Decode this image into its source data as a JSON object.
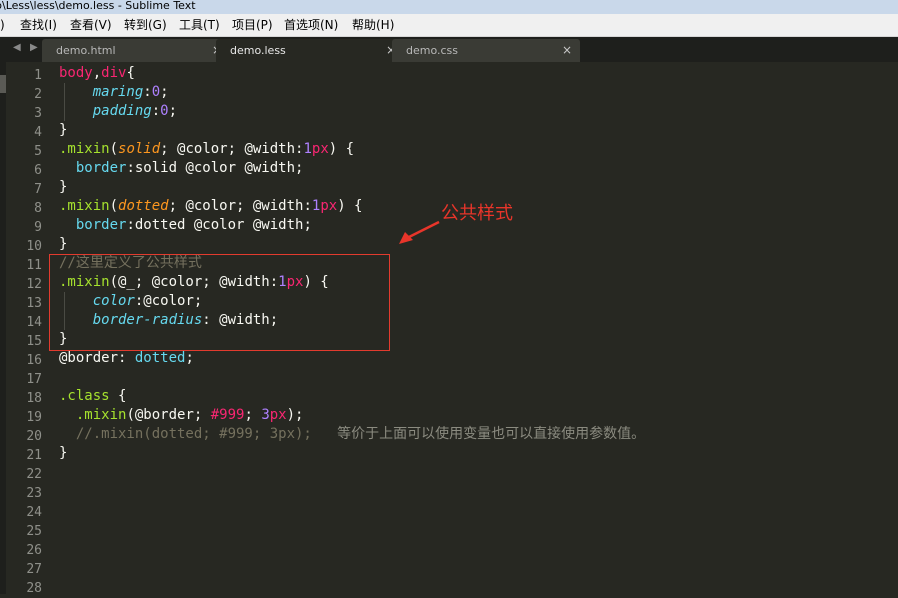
{
  "window": {
    "title": "p\\Less\\less\\demo.less - Sublime Text"
  },
  "menu": [
    ")",
    "查找(I)",
    "查看(V)",
    "转到(G)",
    "工具(T)",
    "项目(P)",
    "首选项(N)",
    "帮助(H)"
  ],
  "tabs": [
    {
      "label": "demo.html",
      "close": "×"
    },
    {
      "label": "demo.less",
      "close": "×"
    },
    {
      "label": "demo.css",
      "close": "×"
    }
  ],
  "nav": {
    "prev": "◀",
    "next": "▶"
  },
  "line_numbers": [
    "1",
    "2",
    "3",
    "4",
    "5",
    "6",
    "7",
    "8",
    "9",
    "10",
    "11",
    "12",
    "13",
    "14",
    "15",
    "16",
    "17",
    "18",
    "19",
    "20",
    "21",
    "22",
    "23",
    "24",
    "25",
    "26",
    "27",
    "28"
  ],
  "code_lines": [
    [
      [
        "tag",
        "body"
      ],
      [
        "plain",
        ","
      ],
      [
        "tag",
        "div"
      ],
      [
        "plain",
        "{"
      ]
    ],
    [
      [
        "plain",
        "    "
      ],
      [
        "prop",
        "maring"
      ],
      [
        "plain",
        ":"
      ],
      [
        "num",
        "0"
      ],
      [
        "plain",
        ";"
      ]
    ],
    [
      [
        "plain",
        "    "
      ],
      [
        "prop",
        "padding"
      ],
      [
        "plain",
        ":"
      ],
      [
        "num",
        "0"
      ],
      [
        "plain",
        ";"
      ]
    ],
    [
      [
        "plain",
        "}"
      ]
    ],
    [
      [
        "fn",
        ".mixin"
      ],
      [
        "plain",
        "("
      ],
      [
        "arg",
        "solid"
      ],
      [
        "plain",
        "; @color; @width:"
      ],
      [
        "num",
        "1"
      ],
      [
        "tag",
        "px"
      ],
      [
        "plain",
        ") {"
      ]
    ],
    [
      [
        "plain",
        "  "
      ],
      [
        "prop-n",
        "border"
      ],
      [
        "plain",
        ":solid @color @width;"
      ]
    ],
    [
      [
        "plain",
        "}"
      ]
    ],
    [
      [
        "fn",
        ".mixin"
      ],
      [
        "plain",
        "("
      ],
      [
        "arg",
        "dotted"
      ],
      [
        "plain",
        "; @color; @width:"
      ],
      [
        "num",
        "1"
      ],
      [
        "tag",
        "px"
      ],
      [
        "plain",
        ") {"
      ]
    ],
    [
      [
        "plain",
        "  "
      ],
      [
        "prop-n",
        "border"
      ],
      [
        "plain",
        ":dotted @color @width;"
      ]
    ],
    [
      [
        "plain",
        "}"
      ]
    ],
    [
      [
        "cmt",
        "//这里定义了公共样式"
      ]
    ],
    [
      [
        "fn",
        ".mixin"
      ],
      [
        "plain",
        "(@_; @color; @width:"
      ],
      [
        "num",
        "1"
      ],
      [
        "tag",
        "px"
      ],
      [
        "plain",
        ") {"
      ]
    ],
    [
      [
        "plain",
        "    "
      ],
      [
        "prop",
        "color"
      ],
      [
        "plain",
        ":@color;"
      ]
    ],
    [
      [
        "plain",
        "    "
      ],
      [
        "prop",
        "border-radius"
      ],
      [
        "plain",
        ": @width;"
      ]
    ],
    [
      [
        "plain",
        "}"
      ]
    ],
    [
      [
        "plain",
        "@border: "
      ],
      [
        "prop-n",
        "dotted"
      ],
      [
        "plain",
        ";"
      ]
    ],
    [],
    [
      [
        "fn",
        ".class"
      ],
      [
        "plain",
        " {"
      ]
    ],
    [
      [
        "plain",
        "  "
      ],
      [
        "fn",
        ".mixin"
      ],
      [
        "plain",
        "(@border; "
      ],
      [
        "tag",
        "#999"
      ],
      [
        "plain",
        "; "
      ],
      [
        "num",
        "3"
      ],
      [
        "tag",
        "px"
      ],
      [
        "plain",
        ");"
      ]
    ],
    [
      [
        "plain",
        "  "
      ],
      [
        "cmt",
        "//.mixin(dotted; #999; 3px);"
      ],
      [
        "plain",
        "   "
      ],
      [
        "note",
        "等价于上面可以使用变量也可以直接使用参数值。"
      ]
    ],
    [
      [
        "plain",
        "}"
      ]
    ],
    [],
    [],
    [],
    [],
    [],
    [],
    []
  ],
  "annotation": {
    "label": "公共样式",
    "color": "#e8352a"
  },
  "colors": {
    "background": "#272822",
    "keyword": "#f92672",
    "property": "#66d9ef",
    "number": "#ae81ff",
    "function": "#a6e22e",
    "argument": "#fd971f",
    "comment": "#75715e"
  }
}
